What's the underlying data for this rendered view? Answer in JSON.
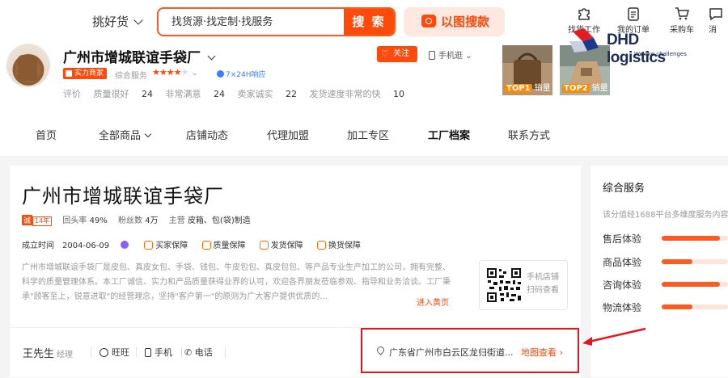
{
  "topbar": {
    "category": "挑好货",
    "search_value": "找货源·找定制·找服务",
    "search_button": "搜 索",
    "image_search": "以图搜款",
    "icons": [
      {
        "label": "找货工作",
        "icon": "puzzle-icon"
      },
      {
        "label": "我的订单",
        "icon": "clipboard-icon"
      },
      {
        "label": "采购车",
        "icon": "cart-icon"
      },
      {
        "label": "消",
        "icon": "message-icon"
      }
    ]
  },
  "watermark": {
    "name": "DHD logistics",
    "tagline": "We like challenges"
  },
  "store": {
    "name": "广州市增城联谊手袋厂",
    "badge": "实力商家",
    "service_label": "综合服务",
    "stars": "★★★★",
    "star_off": "★",
    "response": "7×24H响应",
    "follow": "关注",
    "mobile_shop": "手机逛",
    "evaluation_label": "评价",
    "evaluations": [
      {
        "label": "质量很好",
        "value": "24"
      },
      {
        "label": "非常满意",
        "value": "24"
      },
      {
        "label": "卖家诚实",
        "value": "22"
      },
      {
        "label": "发货速度非常的快",
        "value": "10"
      }
    ],
    "top_products": [
      {
        "rank": "TOP1",
        "label": "销量"
      },
      {
        "rank": "TOP2",
        "label": "销量"
      }
    ]
  },
  "nav": {
    "items": [
      "首页",
      "全部商品",
      "店铺动态",
      "代理加盟",
      "加工专区",
      "工厂档案",
      "联系方式"
    ],
    "active": "工厂档案"
  },
  "factory": {
    "title": "广州市增城联谊手袋厂",
    "cheng": "诚",
    "years": "14年",
    "repurchase_label": "回头率",
    "repurchase": "49%",
    "fans_label": "粉丝数",
    "fans": "4万",
    "main_label": "主营",
    "main": "皮箱、包(袋)制造",
    "founded_label": "成立时间",
    "founded": "2004-06-09",
    "guarantees": [
      "买家保障",
      "质量保障",
      "发货保障",
      "换货保障"
    ],
    "description": "广州市增城联谊手袋厂是皮包、真皮女包、手袋、钱包、牛皮包包、真皮包包、等产品专业生产加工的公司，拥有完整、科学的质量管理体系。本工厂诚信、实力和产品质量获得业界的认可，欢迎各界朋友莅临参观、指导和业务洽谈。工厂秉承\"顾客至上，锐意进取\"的经营理念，坚持\"客户第一\"的原则为广大客户提供优质的...",
    "enter_link": "进入黄页",
    "qr_text": "手机店铺扫码查看",
    "contact_name": "王先生",
    "contact_title": "经理",
    "contacts": [
      "旺旺",
      "手机",
      "电话"
    ],
    "address": "广东省广州市白云区龙归街道...",
    "map_link": "地图查看"
  },
  "side": {
    "title": "综合服务",
    "subtitle": "该分值经1688平台多维度服务内容",
    "metrics": [
      {
        "label": "售后体验",
        "value": 0.88
      },
      {
        "label": "商品体验",
        "value": 0.46
      },
      {
        "label": "咨询体验",
        "value": 0.88
      },
      {
        "label": "物流体验",
        "value": 0.46
      }
    ]
  }
}
